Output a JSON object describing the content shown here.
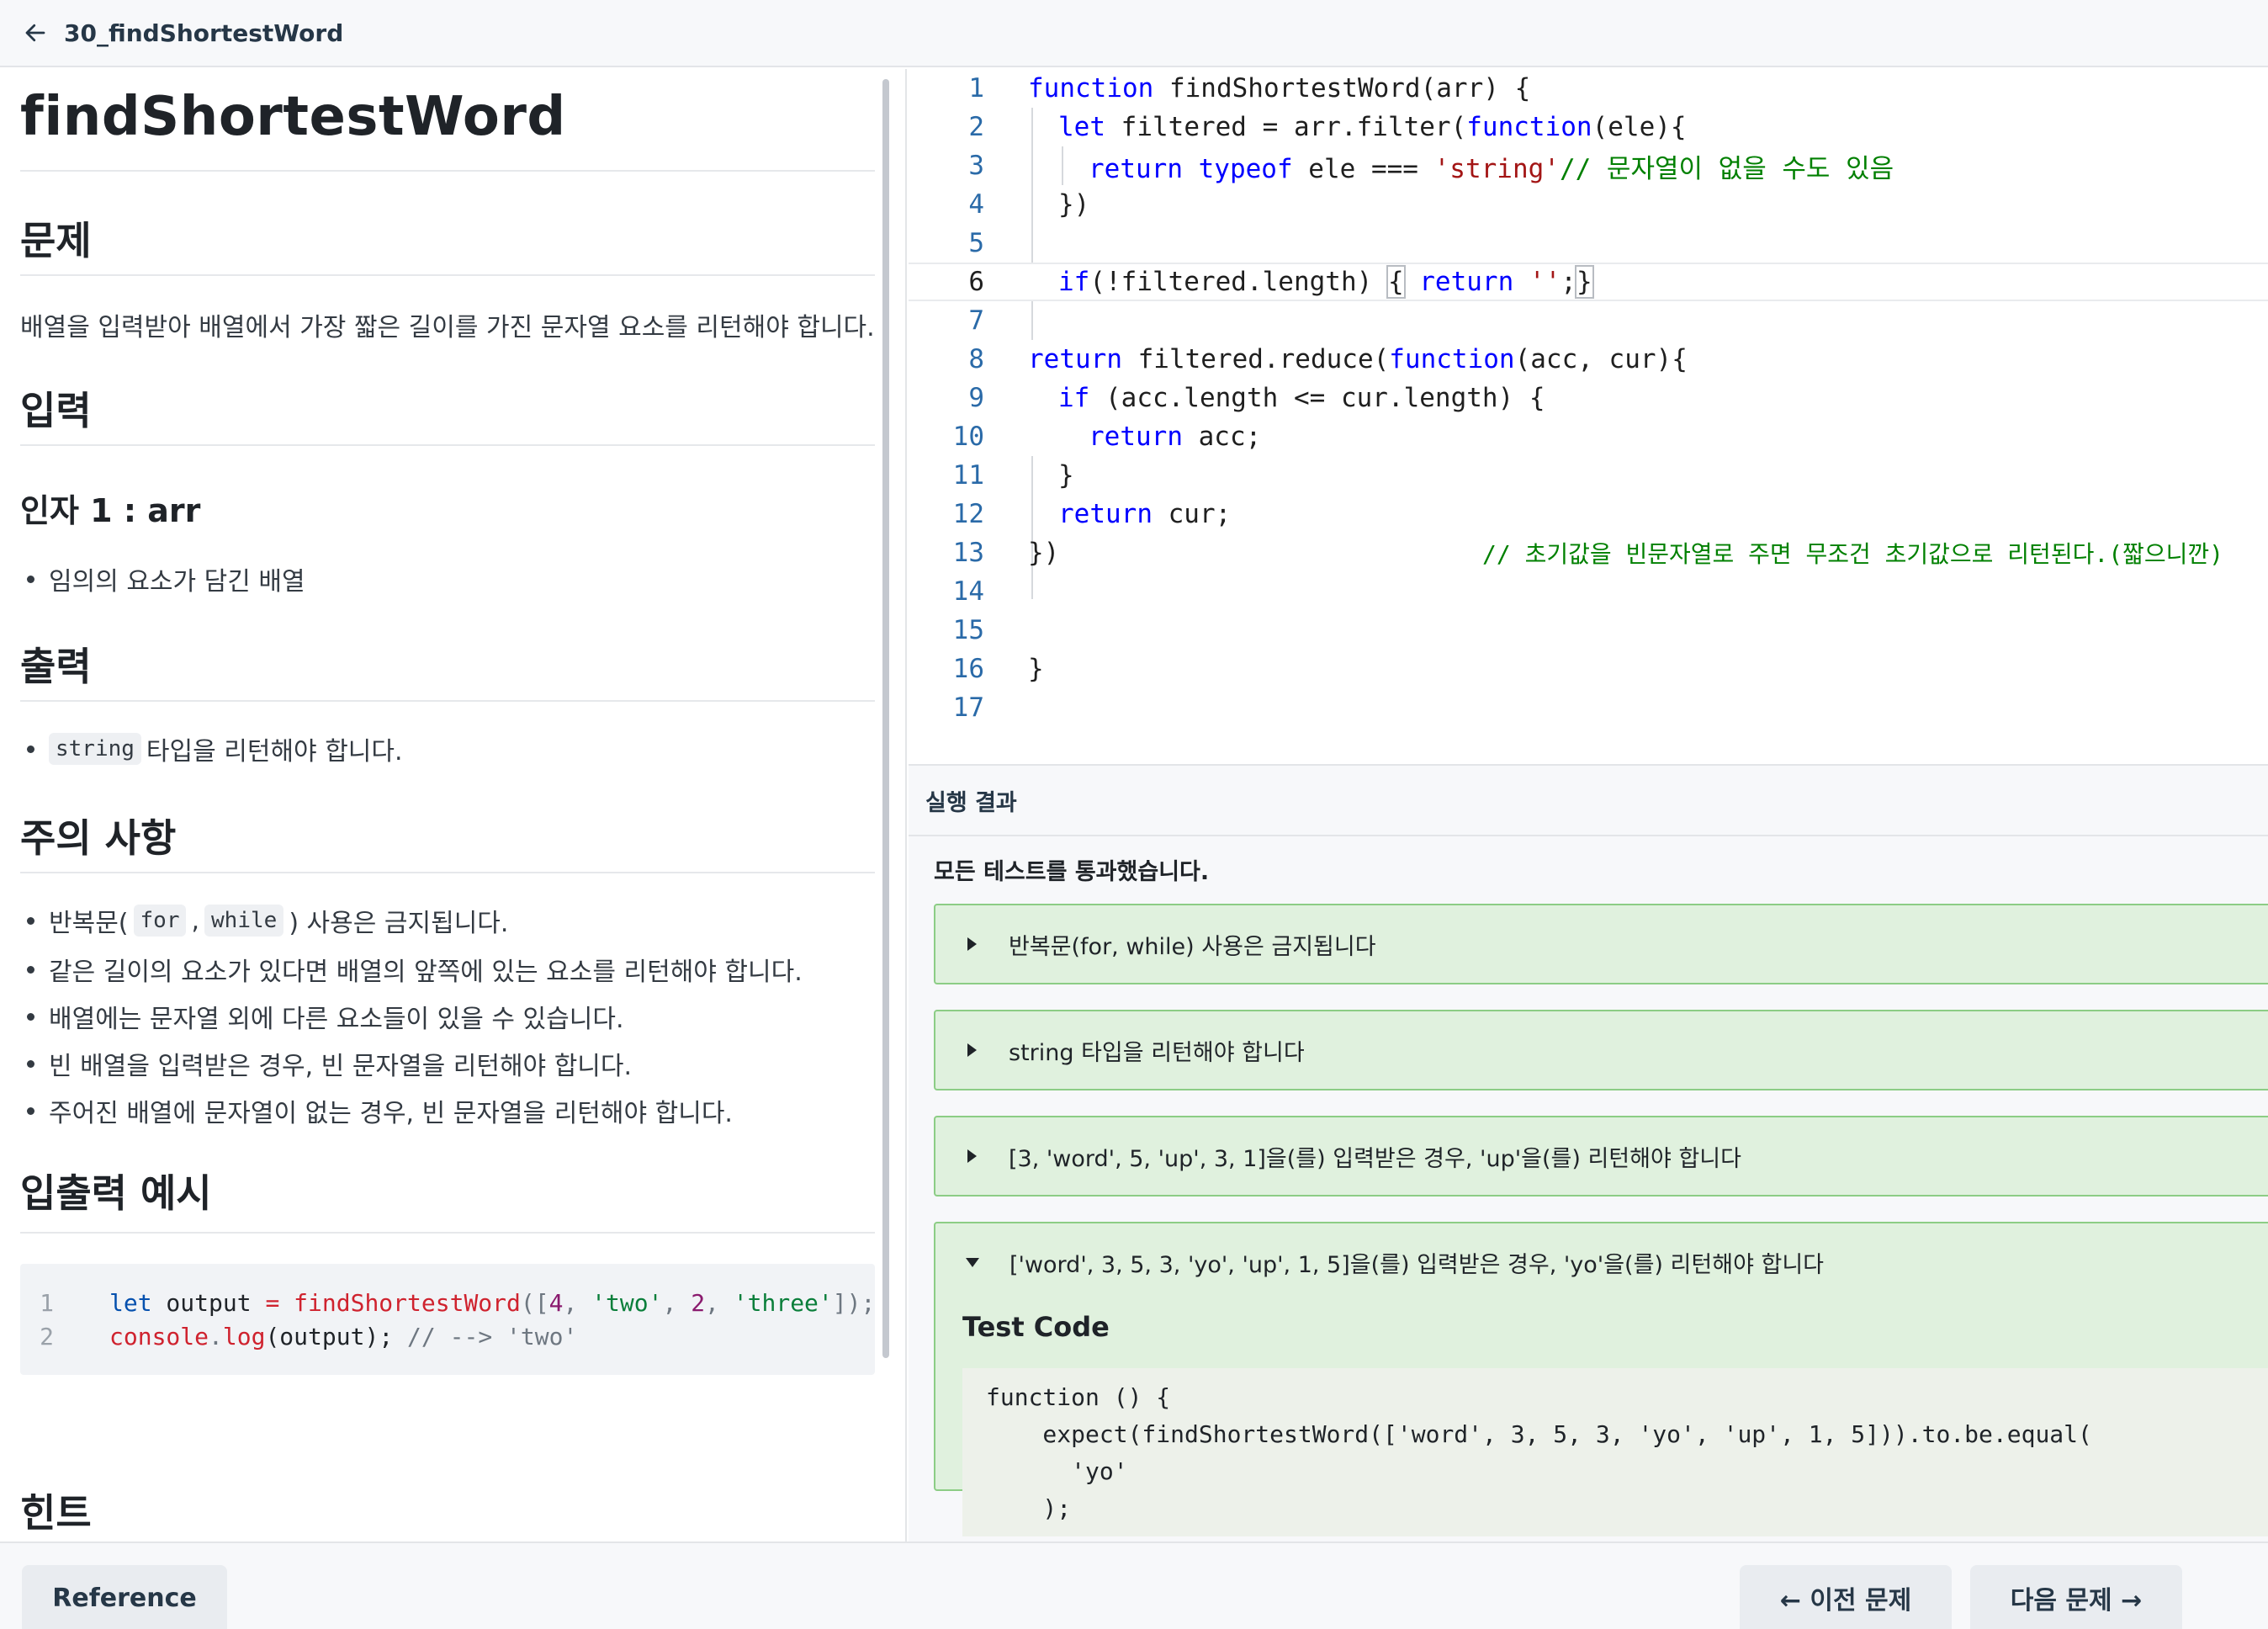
{
  "header": {
    "title": "30_findShortestWord"
  },
  "problem": {
    "title": "findShortestWord",
    "section_problem": "문제",
    "problem_text": "배열을 입력받아 배열에서 가장 짧은 길이를 가진 문자열 요소를 리턴해야 합니다.",
    "section_input": "입력",
    "arg_title": "인자 1 : arr",
    "arg_desc": "임의의 요소가 담긴 배열",
    "section_output": "출력",
    "output_code": "string",
    "output_desc": "타입을 리턴해야 합니다.",
    "section_notes": "주의 사항",
    "note1_pre": "반복문(",
    "note1_code1": "for",
    "note1_sep": ",",
    "note1_code2": "while",
    "note1_post": ") 사용은 금지됩니다.",
    "note2": "같은 길이의 요소가 있다면 배열의 앞쪽에 있는 요소를 리턴해야 합니다.",
    "note3": "배열에는 문자열 외에 다른 요소들이 있을 수 있습니다.",
    "note4": "빈 배열을 입력받은 경우, 빈 문자열을 리턴해야 합니다.",
    "note5": "주어진 배열에 문자열이 없는 경우, 빈 문자열을 리턴해야 합니다.",
    "section_example": "입출력 예시",
    "example": {
      "ln1": "1",
      "ln2": "2",
      "l1_let": "let",
      "l1_var": " output ",
      "l1_eq": "=",
      "l1_fn": " findShortestWord",
      "l1_p1": "([",
      "l1_n4": "4",
      "l1_c1": ", ",
      "l1_two": "'two'",
      "l1_c2": ", ",
      "l1_n2": "2",
      "l1_c3": ", ",
      "l1_three": "'three'",
      "l1_end": "]);",
      "l2_console": "console",
      "l2_dot": ".",
      "l2_log": "log",
      "l2_args": "(output); ",
      "l2_cm": "// --> 'two'"
    },
    "section_hint": "힌트"
  },
  "editor": {
    "lines": [
      {
        "n": "1"
      },
      {
        "n": "2"
      },
      {
        "n": "3"
      },
      {
        "n": "4"
      },
      {
        "n": "5"
      },
      {
        "n": "6"
      },
      {
        "n": "7"
      },
      {
        "n": "8"
      },
      {
        "n": "9"
      },
      {
        "n": "10"
      },
      {
        "n": "11"
      },
      {
        "n": "12"
      },
      {
        "n": "13"
      },
      {
        "n": "14"
      },
      {
        "n": "15"
      },
      {
        "n": "16"
      },
      {
        "n": "17"
      }
    ],
    "t1_kw": "function",
    "t1_rest": " findShortestWord(arr) {",
    "t2_kw": "let",
    "t2_mid": " filtered = arr.filter(",
    "t2_kw2": "function",
    "t2_rest": "(ele){",
    "t3_kw": "return",
    "t3_kw2": " typeof",
    "t3_mid": " ele === ",
    "t3_str": "'string'",
    "t3_cm": "// 문자열이 없을 수도 있음",
    "t4": "})",
    "t6_kw": "if",
    "t6_mid": "(!filtered.length) ",
    "t6_ob": "{",
    "t6_kw2": " return",
    "t6_str": " ''",
    "t6_semi": ";",
    "t6_cb": "}",
    "t8_kw": "return",
    "t8_mid": " filtered.reduce(",
    "t8_kw2": "function",
    "t8_rest": "(acc, cur){",
    "t9_kw": "if",
    "t9_rest": " (acc.length <= cur.length) {",
    "t10_kw": "return",
    "t10_rest": " acc;",
    "t11": "}",
    "t12_kw": "return",
    "t12_rest": " cur;",
    "t13": "})",
    "t13_cm": "// 초기값을 빈문자열로 주면 무조건 초기값으로 리턴된다.(짧으니깐)",
    "t16": "}"
  },
  "results": {
    "header": "실행 결과",
    "summary": "모든 테스트를 통과했습니다.",
    "tests": [
      "반복문(for, while) 사용은 금지됩니다",
      "string 타입을 리턴해야 합니다",
      "[3, 'word', 5, 'up', 3, 1]을(를) 입력받은 경우, 'up'을(를) 리턴해야 합니다",
      "['word', 3, 5, 3, 'yo', 'up', 1, 5]을(를) 입력받은 경우, 'yo'을(를) 리턴해야 합니다"
    ],
    "test_code_title": "Test Code",
    "test_code": [
      "function () {",
      "    expect(findShortestWord(['word', 3, 5, 3, 'yo', 'up', 1, 5])).to.be.equal(",
      "      'yo'",
      "    );"
    ]
  },
  "footer": {
    "reference": "Reference",
    "prev": "← 이전 문제",
    "next": "다음 문제 →"
  },
  "colors": {
    "pass_bg": "#e0f1de",
    "pass_border": "#8ccd85",
    "keyword": "#0000ff",
    "comment": "#008000",
    "string": "#a31515"
  },
  "icons": {
    "back": "arrow-left-icon",
    "collapsed": "triangle-right-icon",
    "expanded": "triangle-down-icon"
  }
}
